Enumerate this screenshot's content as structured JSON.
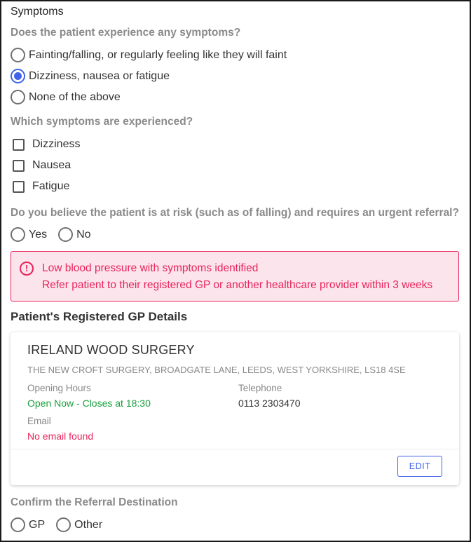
{
  "section": {
    "title": "Symptoms"
  },
  "q_symptoms": {
    "label": "Does the patient experience any symptoms?",
    "options": [
      {
        "label": "Fainting/falling, or regularly feeling like they will faint",
        "checked": false
      },
      {
        "label": "Dizziness, nausea or fatigue",
        "checked": true
      },
      {
        "label": "None of the above",
        "checked": false
      }
    ]
  },
  "q_which": {
    "label": "Which symptoms are experienced?",
    "options": [
      {
        "label": "Dizziness",
        "checked": false
      },
      {
        "label": "Nausea",
        "checked": false
      },
      {
        "label": "Fatigue",
        "checked": false
      }
    ]
  },
  "q_risk": {
    "label": "Do you believe the patient is at risk (such as of falling) and requires an urgent referral?",
    "options": [
      "Yes",
      "No"
    ]
  },
  "alert": {
    "icon": "!",
    "line1": "Low blood pressure with symptoms identified",
    "line2": "Refer patient to their registered GP or another healthcare provider within 3 weeks"
  },
  "gp": {
    "heading": "Patient's Registered GP Details",
    "name": "IRELAND WOOD SURGERY",
    "address": "THE NEW CROFT SURGERY, BROADGATE LANE, LEEDS, WEST YORKSHIRE, LS18 4SE",
    "opening_label": "Opening Hours",
    "opening_value": "Open Now - Closes at 18:30",
    "telephone_label": "Telephone",
    "telephone_value": "0113 2303470",
    "email_label": "Email",
    "email_value": "No email found",
    "edit_label": "EDIT"
  },
  "q_destination": {
    "label": "Confirm the Referral Destination",
    "options": [
      "GP",
      "Other"
    ]
  },
  "colors": {
    "accent": "#3f63e8",
    "alert": "#e8245b",
    "alert_bg": "#fce4ec",
    "open_green": "#1a9f3c"
  }
}
